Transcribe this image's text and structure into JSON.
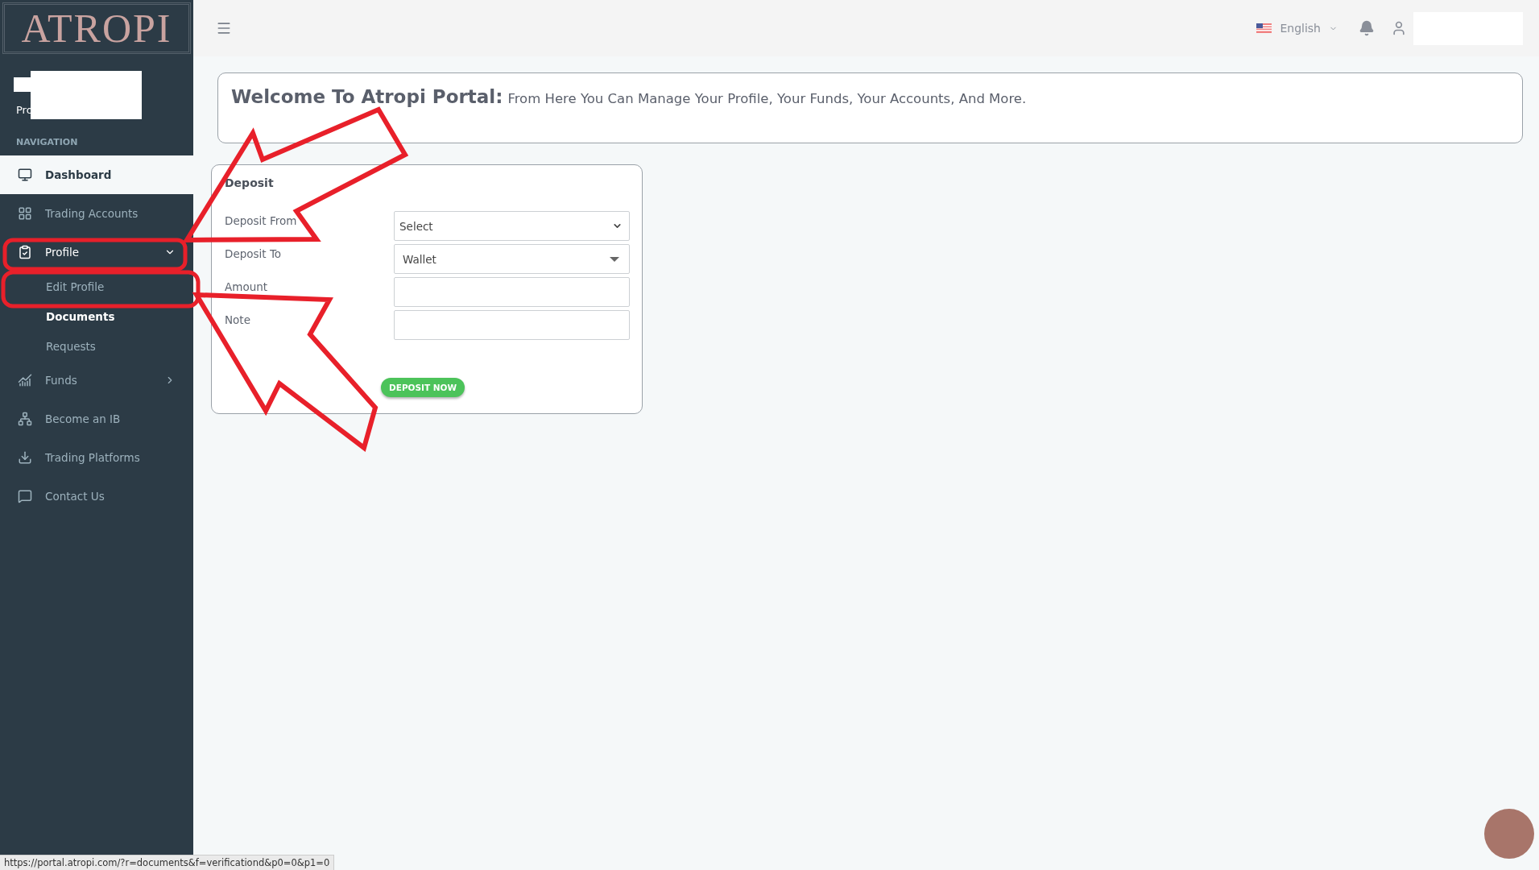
{
  "sidebar": {
    "logo": "ATROPI",
    "user_label": "Pro",
    "section_title": "NAVIGATION",
    "items": [
      {
        "label": "Dashboard",
        "selected": true,
        "expanded": false
      },
      {
        "label": "Trading Accounts",
        "selected": false,
        "expanded": false
      },
      {
        "label": "Profile",
        "selected": false,
        "expanded": true,
        "children": [
          {
            "label": "Edit Profile",
            "selected": false
          },
          {
            "label": "Documents",
            "selected": true
          },
          {
            "label": "Requests",
            "selected": false
          }
        ]
      },
      {
        "label": "Funds",
        "selected": false,
        "expanded": false
      },
      {
        "label": "Become an IB",
        "selected": false
      },
      {
        "label": "Trading Platforms",
        "selected": false
      },
      {
        "label": "Contact Us",
        "selected": false
      }
    ]
  },
  "header": {
    "language": "English"
  },
  "welcome": {
    "title": "Welcome To Atropi Portal:",
    "text": "From Here You Can Manage Your Profile, Your Funds, Your Accounts, And More."
  },
  "deposit": {
    "title": "Deposit",
    "fields": [
      {
        "label": "Deposit From",
        "kind": "native-select",
        "value": "Select"
      },
      {
        "label": "Deposit To",
        "kind": "dropdown",
        "value": "Wallet"
      },
      {
        "label": "Amount",
        "kind": "input"
      },
      {
        "label": "Note",
        "kind": "input"
      }
    ],
    "button": "DEPOSIT NOW"
  },
  "status_bar": {
    "url": "https://portal.atropi.com/?r=documents&f=verificationd&p0=0&p1=0"
  }
}
